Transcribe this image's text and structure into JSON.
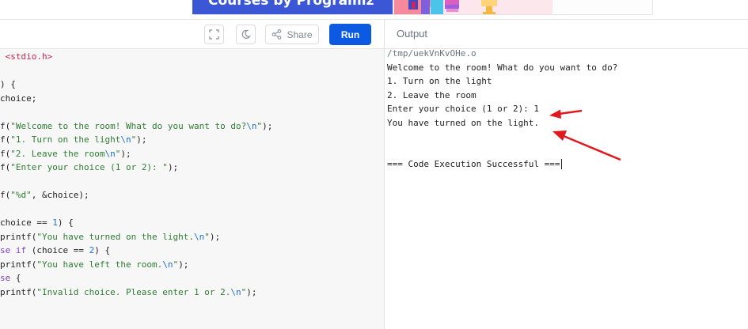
{
  "banner": {
    "text": "Courses by Programiz",
    "bg_color": "#fbe7ec",
    "left_color": "#3c57d6"
  },
  "toolbar": {
    "fullscreen_icon": "fullscreen-icon",
    "theme_icon": "moon-icon",
    "share_icon": "share-icon",
    "share_label": "Share",
    "run_label": "Run",
    "run_color": "#0b5ae1"
  },
  "output_panel": {
    "title": "Output",
    "lines": [
      "/tmp/uekVnKvOHe.o",
      "Welcome to the room! What do you want to do?",
      "1. Turn on the light",
      "2. Leave the room",
      "Enter your choice (1 or 2): 1",
      "You have turned on the light.",
      "",
      "",
      "=== Code Execution Successful ==="
    ],
    "annotation_color": "#e0191f"
  },
  "code": {
    "lines": [
      [
        {
          "t": "inc",
          "v": " <stdio.h>"
        }
      ],
      [],
      [
        {
          "t": "pl",
          "v": ") {"
        }
      ],
      [
        {
          "t": "pl",
          "v": "choice;"
        }
      ],
      [],
      [
        {
          "t": "pl",
          "v": "f("
        },
        {
          "t": "str",
          "v": "\"Welcome to the room! What do you want to do?"
        },
        {
          "t": "esc",
          "v": "\\n"
        },
        {
          "t": "str",
          "v": "\""
        },
        {
          "t": "pl",
          "v": ");"
        }
      ],
      [
        {
          "t": "pl",
          "v": "f("
        },
        {
          "t": "str",
          "v": "\"1. Turn on the light"
        },
        {
          "t": "esc",
          "v": "\\n"
        },
        {
          "t": "str",
          "v": "\""
        },
        {
          "t": "pl",
          "v": ");"
        }
      ],
      [
        {
          "t": "pl",
          "v": "f("
        },
        {
          "t": "str",
          "v": "\"2. Leave the room"
        },
        {
          "t": "esc",
          "v": "\\n"
        },
        {
          "t": "str",
          "v": "\""
        },
        {
          "t": "pl",
          "v": ");"
        }
      ],
      [
        {
          "t": "pl",
          "v": "f("
        },
        {
          "t": "str",
          "v": "\"Enter your choice (1 or 2): \""
        },
        {
          "t": "pl",
          "v": ");"
        }
      ],
      [],
      [
        {
          "t": "pl",
          "v": "f("
        },
        {
          "t": "str",
          "v": "\"%d\""
        },
        {
          "t": "pl",
          "v": ", &choice);"
        }
      ],
      [],
      [
        {
          "t": "pl",
          "v": "choice == "
        },
        {
          "t": "num",
          "v": "1"
        },
        {
          "t": "pl",
          "v": ") {"
        }
      ],
      [
        {
          "t": "pl",
          "v": "printf("
        },
        {
          "t": "str",
          "v": "\"You have turned on the light."
        },
        {
          "t": "esc",
          "v": "\\n"
        },
        {
          "t": "str",
          "v": "\""
        },
        {
          "t": "pl",
          "v": ");"
        }
      ],
      [
        {
          "t": "kw",
          "v": "se if"
        },
        {
          "t": "pl",
          "v": " (choice == "
        },
        {
          "t": "num",
          "v": "2"
        },
        {
          "t": "pl",
          "v": ") {"
        }
      ],
      [
        {
          "t": "pl",
          "v": "printf("
        },
        {
          "t": "str",
          "v": "\"You have left the room."
        },
        {
          "t": "esc",
          "v": "\\n"
        },
        {
          "t": "str",
          "v": "\""
        },
        {
          "t": "pl",
          "v": ");"
        }
      ],
      [
        {
          "t": "kw",
          "v": "se"
        },
        {
          "t": "pl",
          "v": " {"
        }
      ],
      [
        {
          "t": "pl",
          "v": "printf("
        },
        {
          "t": "str",
          "v": "\"Invalid choice. Please enter 1 or 2."
        },
        {
          "t": "esc",
          "v": "\\n"
        },
        {
          "t": "str",
          "v": "\""
        },
        {
          "t": "pl",
          "v": ");"
        }
      ]
    ]
  }
}
